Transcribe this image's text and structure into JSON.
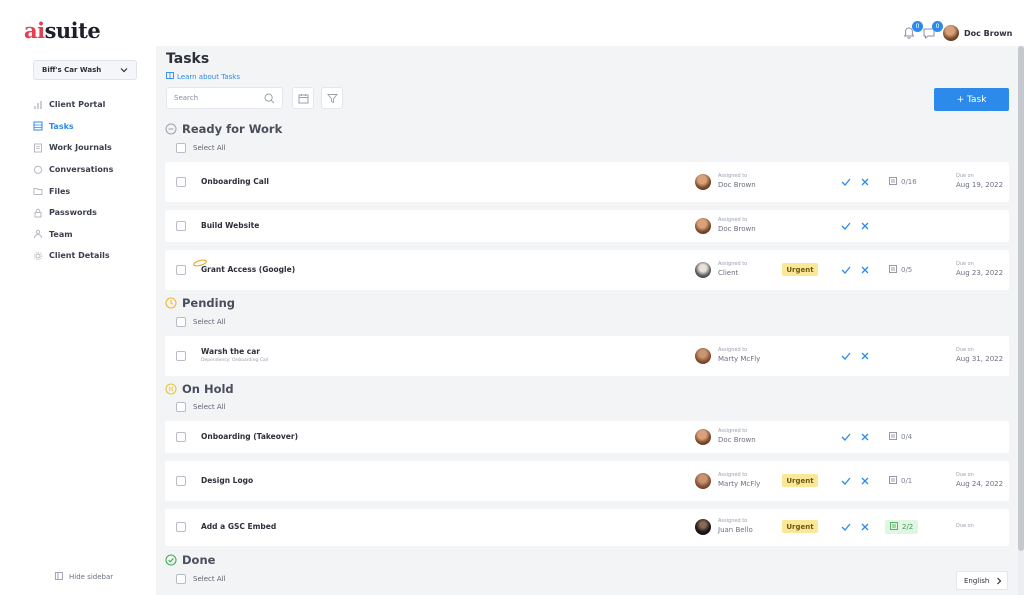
{
  "app": {
    "logo_accent": "ai",
    "logo_rest": "suite"
  },
  "header": {
    "notifications_count": "0",
    "messages_count": "0",
    "user_name": "Doc Brown"
  },
  "sidebar": {
    "workspace": "Biff's Car Wash",
    "items": [
      {
        "label": "Client Portal",
        "icon": "bar-chart-icon"
      },
      {
        "label": "Tasks",
        "icon": "tasks-icon",
        "active": true
      },
      {
        "label": "Work Journals",
        "icon": "journal-icon"
      },
      {
        "label": "Conversations",
        "icon": "chat-icon"
      },
      {
        "label": "Files",
        "icon": "folder-icon"
      },
      {
        "label": "Passwords",
        "icon": "lock-icon"
      },
      {
        "label": "Team",
        "icon": "team-icon"
      },
      {
        "label": "Client Details",
        "icon": "gear-icon"
      }
    ],
    "hide_label": "Hide sidebar"
  },
  "main": {
    "title": "Tasks",
    "learn_link": "Learn about Tasks",
    "search_placeholder": "Search",
    "add_task_label": "+ Task",
    "select_all_label": "Select All",
    "sections": [
      {
        "name": "Ready for Work",
        "status_color": "#9aa0ae",
        "tasks": [
          {
            "title": "Onboarding Call",
            "assigned_label": "Assigned to",
            "assignee": "Doc Brown",
            "urgent": "",
            "count": "0/16",
            "due_label": "Due on",
            "due_date": "Aug 19, 2022"
          },
          {
            "title": "Build Website",
            "assigned_label": "Assigned to",
            "assignee": "Doc Brown",
            "urgent": "",
            "count": "",
            "due_label": "",
            "due_date": ""
          },
          {
            "title": "Grant Access (Google)",
            "assigned_label": "Assigned to",
            "assignee": "Client",
            "urgent": "Urgent",
            "count": "0/5",
            "due_label": "Due on",
            "due_date": "Aug 23, 2022"
          }
        ]
      },
      {
        "name": "Pending",
        "status_color": "#f2b632",
        "tasks": [
          {
            "title": "Warsh the car",
            "subtitle": "Dependency: Onboarding Call",
            "assigned_label": "Assigned to",
            "assignee": "Marty McFly",
            "urgent": "",
            "count": "",
            "due_label": "Due on",
            "due_date": "Aug 31, 2022"
          }
        ]
      },
      {
        "name": "On Hold",
        "status_color": "#e9c43a",
        "tasks": [
          {
            "title": "Onboarding (Takeover)",
            "assigned_label": "Assigned to",
            "assignee": "Doc Brown",
            "urgent": "",
            "count": "0/4",
            "due_label": "",
            "due_date": ""
          },
          {
            "title": "Design Logo",
            "assigned_label": "Assigned to",
            "assignee": "Marty McFly",
            "urgent": "Urgent",
            "count": "0/1",
            "due_label": "Due on",
            "due_date": "Aug 24, 2022"
          },
          {
            "title": "Add a GSC Embed",
            "assigned_label": "Assigned to",
            "assignee": "Juan Bello",
            "urgent": "Urgent",
            "count": "2/2",
            "due_label": "Due on",
            "due_date": ""
          }
        ]
      },
      {
        "name": "Done",
        "status_color": "#3fae54",
        "tasks": []
      }
    ]
  },
  "footer": {
    "language": "English"
  },
  "colors": {
    "accent": "#2c8bea",
    "urgent_bg": "#fbe79a",
    "done_bg": "#e2f5e3"
  }
}
